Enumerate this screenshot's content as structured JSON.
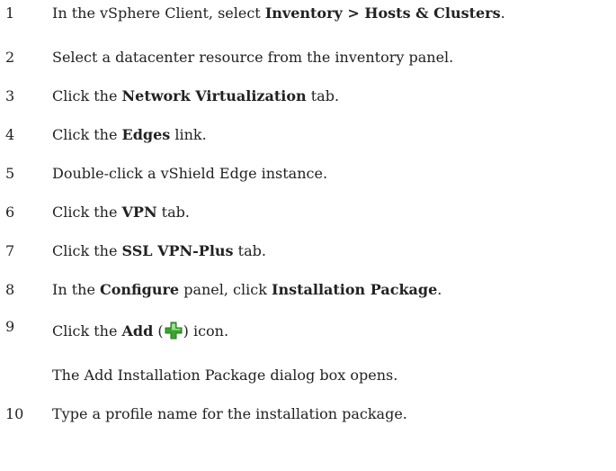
{
  "steps": [
    {
      "num": "1",
      "parts": [
        {
          "t": "In the vSphere Client, select "
        },
        {
          "t": "Inventory > Hosts & Clusters",
          "b": true
        },
        {
          "t": "."
        }
      ]
    },
    {
      "num": "2",
      "parts": [
        {
          "t": "Select a datacenter resource from the inventory panel."
        }
      ]
    },
    {
      "num": "3",
      "parts": [
        {
          "t": "Click the "
        },
        {
          "t": "Network Virtualization",
          "b": true
        },
        {
          "t": " tab."
        }
      ]
    },
    {
      "num": "4",
      "parts": [
        {
          "t": "Click the "
        },
        {
          "t": "Edges",
          "b": true
        },
        {
          "t": " link."
        }
      ]
    },
    {
      "num": "5",
      "parts": [
        {
          "t": "Double-click a vShield Edge instance."
        }
      ]
    },
    {
      "num": "6",
      "parts": [
        {
          "t": "Click the "
        },
        {
          "t": "VPN",
          "b": true
        },
        {
          "t": " tab."
        }
      ]
    },
    {
      "num": "7",
      "parts": [
        {
          "t": "Click the "
        },
        {
          "t": "SSL VPN-Plus",
          "b": true
        },
        {
          "t": " tab."
        }
      ]
    },
    {
      "num": "8",
      "parts": [
        {
          "t": "In the "
        },
        {
          "t": "Configure",
          "b": true
        },
        {
          "t": " panel, click "
        },
        {
          "t": "Installation Package",
          "b": true
        },
        {
          "t": "."
        }
      ]
    },
    {
      "num": "9",
      "parts": [
        {
          "t": "Click the "
        },
        {
          "t": "Add",
          "b": true
        },
        {
          "t": " ("
        },
        {
          "icon": "add-icon"
        },
        {
          "t": ") icon."
        }
      ],
      "note": "The Add Installation Package dialog box opens."
    },
    {
      "num": "10",
      "parts": [
        {
          "t": "Type a profile name for the installation package."
        }
      ]
    }
  ],
  "colors": {
    "text": "#222222",
    "add_icon": "#3aa52e"
  }
}
